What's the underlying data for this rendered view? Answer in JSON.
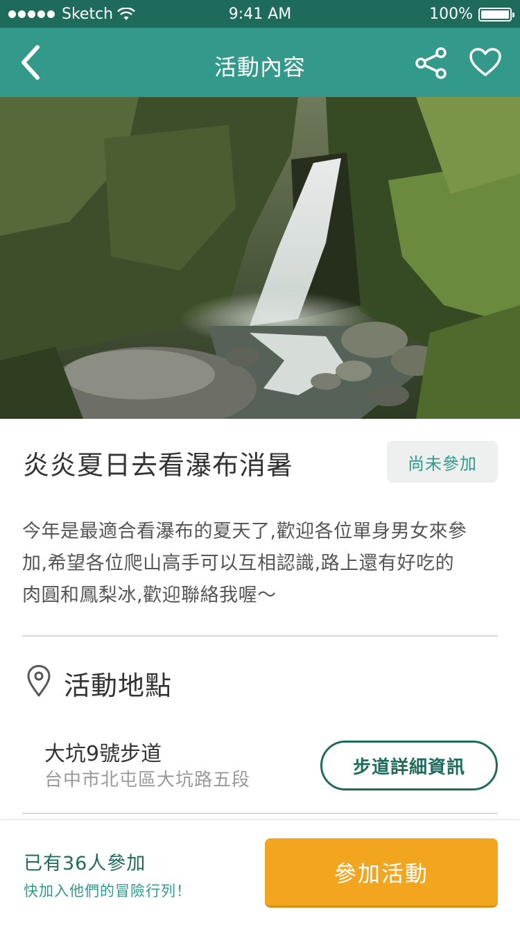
{
  "status_bar": {
    "carrier": "Sketch",
    "time": "9:41 AM",
    "battery": "100%"
  },
  "nav": {
    "title": "活動內容",
    "icons": [
      "back-icon",
      "share-icon",
      "heart-icon"
    ]
  },
  "event": {
    "title": "炎炎夏日去看瀑布消暑",
    "status": "尚未參加",
    "description": [
      "今年是最適合看瀑布的夏天了,歡迎各位單身男女來參",
      "加,希望各位爬山高手可以互相認識,路上還有好吃的",
      "肉圓和鳳梨冰,歡迎聯絡我喔～"
    ]
  },
  "location": {
    "section_title": "活動地點",
    "place_name": "大坑9號步道",
    "address": "台中市北屯區大坑路五段",
    "detail_button": "步道詳細資訊"
  },
  "footer": {
    "participant_count": "已有36人參加",
    "subtitle": "快加入他們的冒險行列！",
    "join_button": "參加活動"
  },
  "colors": {
    "status_bar": "#1e6b5c",
    "nav_bar": "#33998a",
    "accent": "#f2a51f",
    "badge_bg": "#eef0ef"
  }
}
